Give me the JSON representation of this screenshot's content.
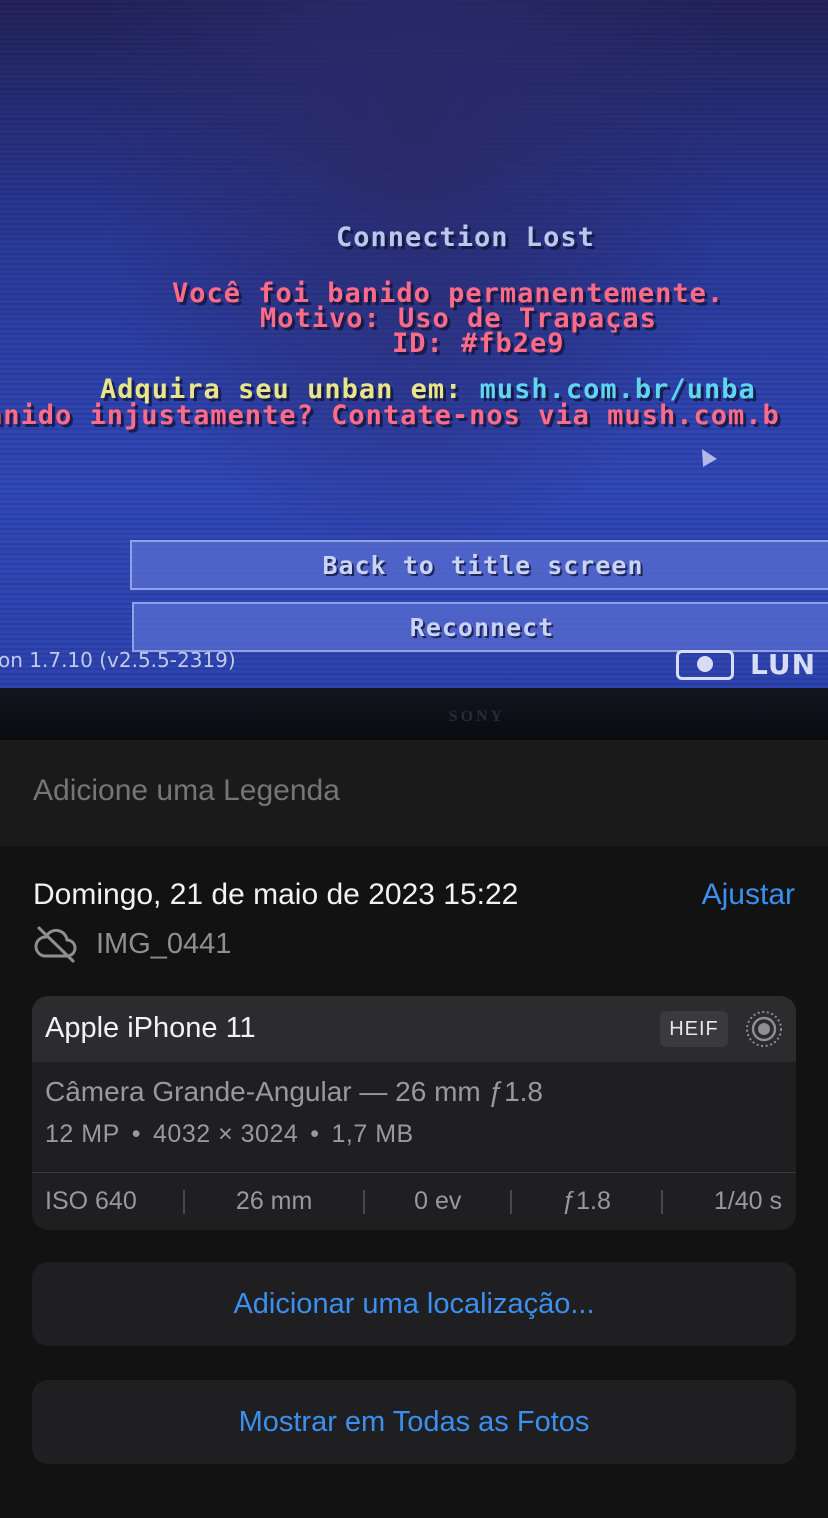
{
  "photo": {
    "tv_brand": "SONY",
    "game_screen": {
      "title": "Connection Lost",
      "ban_line": "Você foi banido permanentemente.",
      "reason_line": "Motivo: Uso de Trapaças",
      "id_line": "ID: #fb2e9",
      "unban_prefix": "Adquira seu unban em: ",
      "unban_link": "mush.com.br/unba",
      "unfair_line": "anido injustamente? Contate-nos via mush.com.b",
      "back_button": "Back to title screen",
      "reconnect_button": "Reconnect",
      "version": "on 1.7.10 (v2.5.5-2319)",
      "client_logo_text": "LUN"
    }
  },
  "caption": {
    "placeholder": "Adicione uma Legenda"
  },
  "info": {
    "date": "Domingo, 21 de maio de 2023 15:22",
    "adjust_label": "Ajustar",
    "filename": "IMG_0441",
    "cloud_icon": "cloud-slash-icon"
  },
  "camera_card": {
    "device": "Apple iPhone 11",
    "format_badge": "HEIF",
    "live_icon": "live-photo-icon",
    "lens": "Câmera Grande-Angular — 26 mm ƒ1.8",
    "megapixels": "12 MP",
    "dimensions": "4032 × 3024",
    "file_size": "1,7 MB",
    "exif": {
      "iso": "ISO 640",
      "focal_length": "26 mm",
      "exposure": "0 ev",
      "aperture": "ƒ1.8",
      "shutter": "1/40 s"
    }
  },
  "actions": {
    "add_location": "Adicionar uma localização...",
    "show_in_all_photos": "Mostrar em Todas as Fotos"
  },
  "colors": {
    "accent": "#3b8ff0",
    "background": "#121212",
    "card": "#1f1f21"
  }
}
